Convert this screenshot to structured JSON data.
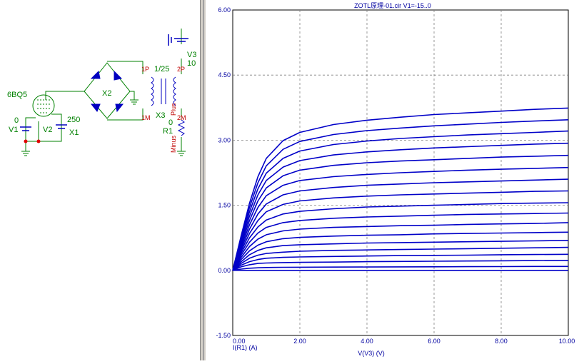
{
  "schematic": {
    "tube_label": "6BQ5",
    "v1_name": "V1",
    "v1_value": "0",
    "v2_name": "V2",
    "v2_value": "250",
    "x1_name": "X1",
    "x2_name": "X2",
    "x3_name": "X3",
    "ratio": "1/25",
    "primary_top": "1P",
    "primary_bottom": "1M",
    "secondary_top": "2P",
    "secondary_bottom": "2M",
    "v3_name": "V3",
    "v3_value": "10",
    "r1_name": "R1",
    "r1_value": "0",
    "plus_label": "Plus",
    "minus_label": "Minus",
    "colors": {
      "wire": "#008000",
      "part": "#0000c0",
      "node": "#e00000",
      "label": "#008000",
      "pin": "#c00000"
    }
  },
  "chart_data": {
    "type": "line",
    "title": "ZOTL原理-01.cir V1=-15..0",
    "xlabel": "V(V3) (V)",
    "ylabel": "I(R1) (A)",
    "xlim": [
      0,
      10
    ],
    "ylim": [
      -1.5,
      6
    ],
    "xticks": [
      "0.00",
      "2.00",
      "4.00",
      "6.00",
      "8.00",
      "10.00"
    ],
    "yticks": [
      "-1.50",
      "0.00",
      "1.50",
      "3.00",
      "4.50",
      "6.00"
    ],
    "grid": true,
    "line_color": "#0000c8",
    "x": [
      0,
      0.25,
      0.5,
      0.75,
      1,
      1.5,
      2,
      3,
      4,
      5,
      6,
      7,
      8,
      9,
      10
    ],
    "series": [
      {
        "values": [
          0,
          0.0,
          0.0,
          0.0,
          0.0,
          0.0,
          0.0,
          0.0,
          0.0,
          0.0,
          0.0,
          0.0,
          0.0,
          0.0,
          0.0
        ]
      },
      {
        "values": [
          0,
          0.03,
          0.05,
          0.06,
          0.065,
          0.07,
          0.072,
          0.075,
          0.077,
          0.08,
          0.082,
          0.085,
          0.087,
          0.09,
          0.09
        ]
      },
      {
        "values": [
          0,
          0.08,
          0.13,
          0.16,
          0.17,
          0.18,
          0.185,
          0.19,
          0.2,
          0.205,
          0.21,
          0.215,
          0.22,
          0.225,
          0.23
        ]
      },
      {
        "values": [
          0,
          0.12,
          0.2,
          0.25,
          0.28,
          0.3,
          0.31,
          0.32,
          0.33,
          0.34,
          0.345,
          0.35,
          0.36,
          0.365,
          0.37
        ]
      },
      {
        "values": [
          0,
          0.16,
          0.28,
          0.35,
          0.39,
          0.42,
          0.44,
          0.46,
          0.47,
          0.48,
          0.49,
          0.5,
          0.51,
          0.52,
          0.53
        ]
      },
      {
        "values": [
          0,
          0.2,
          0.36,
          0.46,
          0.52,
          0.57,
          0.59,
          0.61,
          0.63,
          0.64,
          0.65,
          0.66,
          0.67,
          0.68,
          0.69
        ]
      },
      {
        "values": [
          0,
          0.25,
          0.45,
          0.58,
          0.66,
          0.73,
          0.76,
          0.79,
          0.81,
          0.82,
          0.84,
          0.85,
          0.86,
          0.87,
          0.88
        ]
      },
      {
        "values": [
          0,
          0.3,
          0.55,
          0.72,
          0.82,
          0.91,
          0.95,
          0.99,
          1.01,
          1.03,
          1.04,
          1.06,
          1.07,
          1.08,
          1.1
        ]
      },
      {
        "values": [
          0,
          0.35,
          0.65,
          0.86,
          0.99,
          1.1,
          1.15,
          1.2,
          1.23,
          1.25,
          1.27,
          1.29,
          1.3,
          1.31,
          1.32
        ]
      },
      {
        "values": [
          0,
          0.4,
          0.75,
          1.0,
          1.16,
          1.3,
          1.36,
          1.42,
          1.46,
          1.48,
          1.5,
          1.52,
          1.54,
          1.55,
          1.56
        ]
      },
      {
        "values": [
          0,
          0.45,
          0.85,
          1.15,
          1.35,
          1.52,
          1.6,
          1.67,
          1.71,
          1.74,
          1.76,
          1.78,
          1.8,
          1.82,
          1.83
        ]
      },
      {
        "values": [
          0,
          0.5,
          0.95,
          1.3,
          1.53,
          1.74,
          1.83,
          1.91,
          1.96,
          1.99,
          2.02,
          2.04,
          2.06,
          2.08,
          2.1
        ]
      },
      {
        "values": [
          0,
          0.55,
          1.05,
          1.45,
          1.72,
          1.96,
          2.07,
          2.16,
          2.21,
          2.25,
          2.28,
          2.31,
          2.33,
          2.35,
          2.37
        ]
      },
      {
        "values": [
          0,
          0.6,
          1.15,
          1.6,
          1.9,
          2.18,
          2.31,
          2.42,
          2.48,
          2.52,
          2.55,
          2.58,
          2.61,
          2.63,
          2.65
        ]
      },
      {
        "values": [
          0,
          0.65,
          1.25,
          1.74,
          2.07,
          2.38,
          2.53,
          2.66,
          2.73,
          2.78,
          2.82,
          2.85,
          2.88,
          2.91,
          2.93
        ]
      },
      {
        "values": [
          0,
          0.7,
          1.35,
          1.88,
          2.24,
          2.58,
          2.75,
          2.9,
          2.98,
          3.04,
          3.08,
          3.12,
          3.15,
          3.18,
          3.21
        ]
      },
      {
        "values": [
          0,
          0.75,
          1.45,
          2.02,
          2.41,
          2.79,
          2.97,
          3.13,
          3.22,
          3.28,
          3.33,
          3.37,
          3.41,
          3.44,
          3.47
        ]
      },
      {
        "values": [
          0,
          0.8,
          1.55,
          2.16,
          2.58,
          2.99,
          3.18,
          3.36,
          3.46,
          3.53,
          3.59,
          3.63,
          3.67,
          3.71,
          3.74
        ]
      }
    ]
  }
}
